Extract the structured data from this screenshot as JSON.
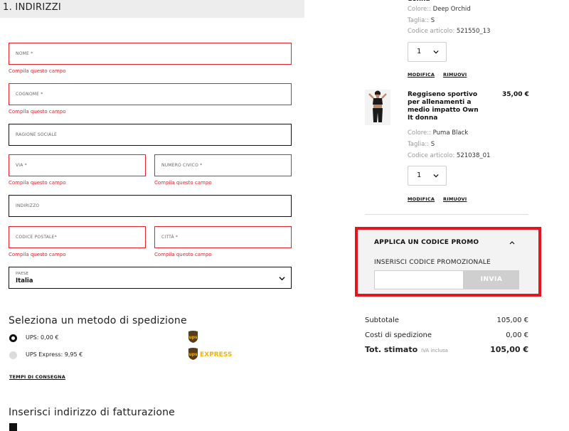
{
  "address_section": {
    "title": "1. INDIRIZZI",
    "error_text": "Compila questo campo",
    "fields": {
      "nome": "NOME *",
      "cognome": "COGNOME *",
      "ragione_sociale": "RAGIONE SOCIALE",
      "via": "VIA *",
      "numero_civico": "NUMERO CIVICO *",
      "indirizzo": "INDIRIZZO",
      "codice_postale": "CODICE POSTALE*",
      "citta": "CITTÀ *"
    },
    "paese": {
      "label": "PAESE",
      "value": "Italia"
    }
  },
  "shipping": {
    "title": "Seleziona un metodo di spedizione",
    "options": [
      {
        "label": "UPS: 0,00 €",
        "selected": true,
        "logo": "ups-logo-icon"
      },
      {
        "label": "UPS Express: 9,95 €",
        "selected": false,
        "logo": "ups-express-logo-icon",
        "logo_text": "EXPRESS"
      }
    ],
    "delivery_times_link": "TEMPI DI CONSEGNA"
  },
  "billing": {
    "title": "Inserisci indirizzo di fatturazione"
  },
  "cart": {
    "item1": {
      "name_fragment": "donna",
      "color_label": "Colore::",
      "color": "Deep Orchid",
      "size_label": "Taglia::",
      "size": "S",
      "code_label": "Codice articolo:",
      "code": "521550_13",
      "qty": "1",
      "edit": "MODIFICA",
      "remove": "RIMUOVI"
    },
    "item2": {
      "name": "Reggiseno sportivo per allenamenti a medio impatto Own It donna",
      "price": "35,00 €",
      "color_label": "Colore::",
      "color": "Puma Black",
      "size_label": "Taglia::",
      "size": "S",
      "code_label": "Codice articolo:",
      "code": "521038_01",
      "qty": "1",
      "edit": "MODIFICA",
      "remove": "RIMUOVI"
    }
  },
  "promo": {
    "title": "APPLICA UN CODICE PROMO",
    "label": "INSERISCI CODICE PROMOZIONALE",
    "input_value": "",
    "button": "INVIA"
  },
  "summary": {
    "subtotal_label": "Subtotale",
    "subtotal": "105,00 €",
    "shipping_label": "Costi di spedizione",
    "shipping": "0,00 €",
    "total_label": "Tot. stimato",
    "vat_note": "IVA inclusa",
    "total": "105,00 €"
  },
  "colors": {
    "error": "#e8212d",
    "highlight": "#e5151f",
    "ups_brown": "#5a3a1c",
    "ups_gold": "#f5b400"
  }
}
